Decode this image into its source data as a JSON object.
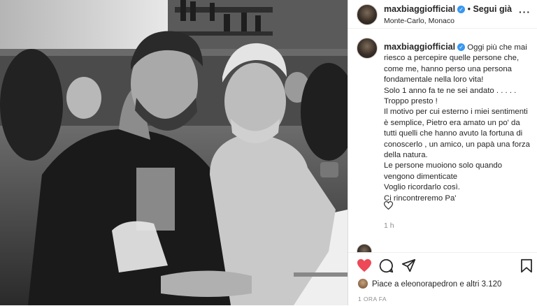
{
  "post": {
    "username": "maxbiaggiofficial",
    "verified_mark": "✓",
    "separator": "•",
    "follow_label": "Segui già",
    "location": "Monte-Carlo, Monaco",
    "more_icon": "more-options-icon"
  },
  "caption": {
    "username": "maxbiaggiofficial",
    "lines": [
      "Oggi più che mai riesco a percepire quelle persone che, come me, hanno perso una persona fondamentale nella loro vita!",
      "Solo 1 anno fa te ne sei andato . . . . .",
      "Troppo presto !",
      "Il motivo per cui esterno i miei sentimenti è semplice, Pietro era amato un po' da tutti quelli che hanno avuto la fortuna di conoscerlo , un amico, un papà una forza della natura.",
      "Le persone muoiono solo quando vengono dimenticate",
      "Voglio ricordarlo così.",
      "Ci rincontreremo Pa'"
    ],
    "time": "1 h"
  },
  "actions": {
    "like_icon": "heart-filled-icon",
    "comment_icon": "comment-icon",
    "share_icon": "share-icon",
    "save_icon": "bookmark-icon",
    "like_color": "#ed4956"
  },
  "likes": {
    "text": "Piace a eleonorapedron e altri 3.120"
  },
  "posted_ago": "1 ORA FA"
}
